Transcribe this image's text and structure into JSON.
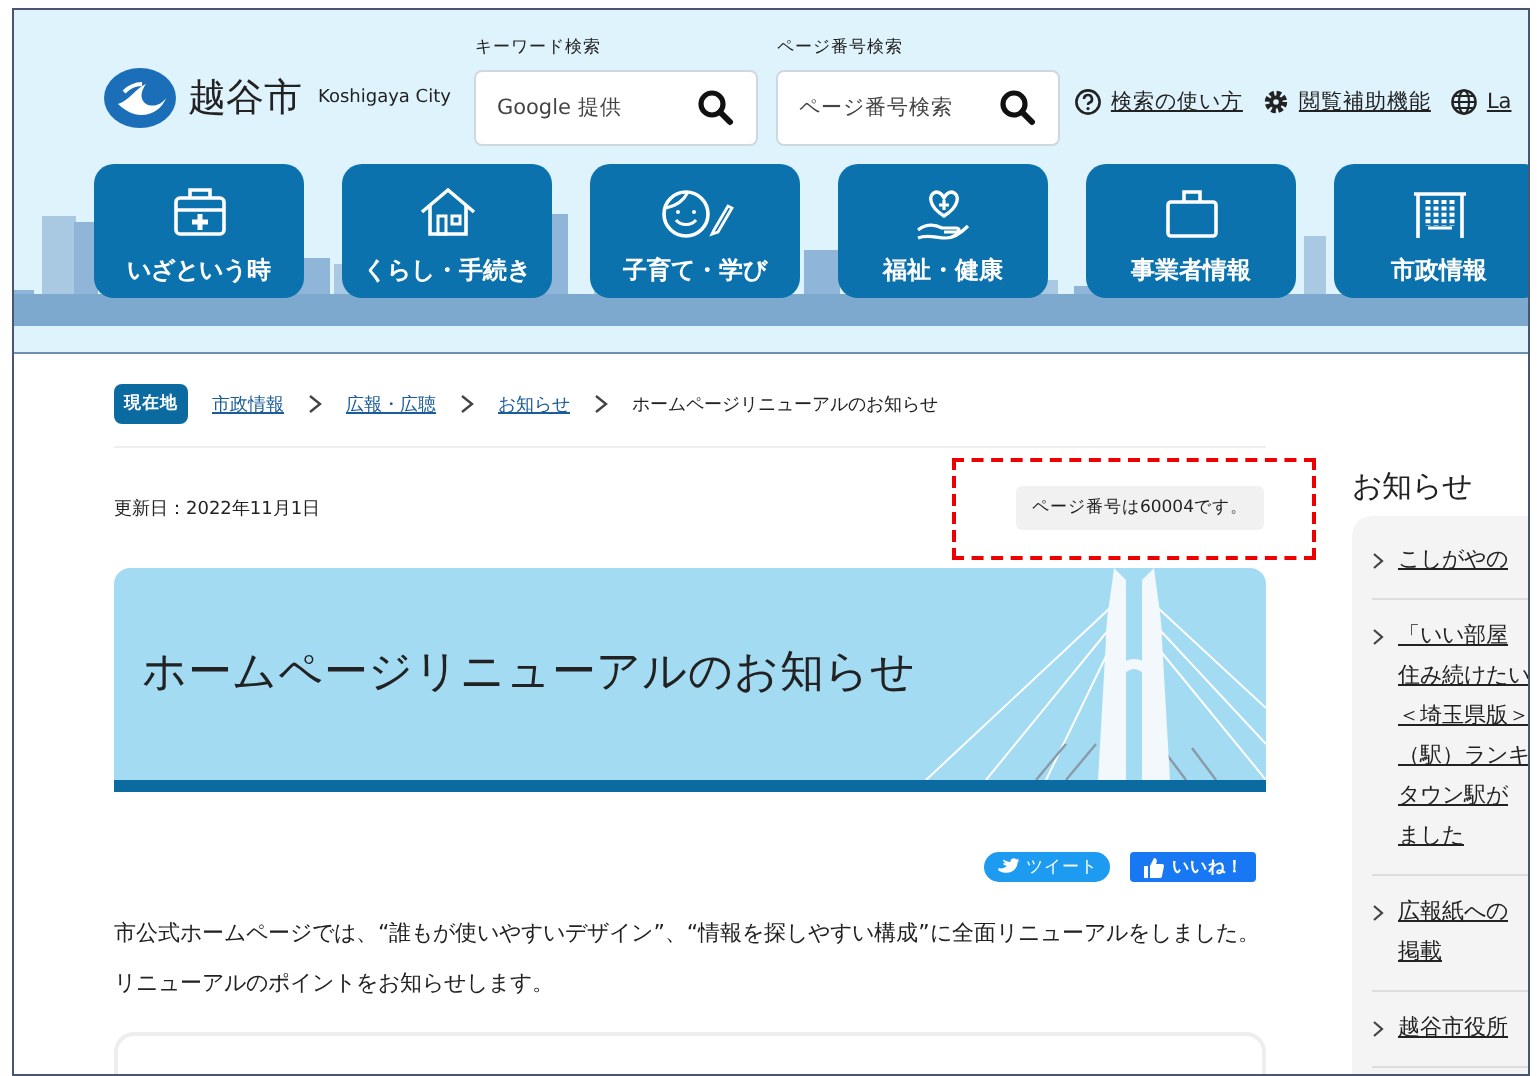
{
  "header": {
    "logo": {
      "name": "越谷市",
      "sub": "Koshigaya City"
    },
    "searches": [
      {
        "label": "キーワード検索",
        "placeholder": "Google 提供"
      },
      {
        "label": "ページ番号検索",
        "placeholder": "ページ番号検索"
      }
    ],
    "links": [
      {
        "kind": "help",
        "label": "検索の使い方"
      },
      {
        "kind": "settings",
        "label": "閲覧補助機能"
      },
      {
        "kind": "language",
        "label": "La"
      }
    ]
  },
  "nav": [
    {
      "kind": "emergency",
      "label": "いざという時"
    },
    {
      "kind": "home",
      "label": "くらし・手続き"
    },
    {
      "kind": "child",
      "label": "子育て・学び"
    },
    {
      "kind": "welfare",
      "label": "福祉・健康"
    },
    {
      "kind": "business",
      "label": "事業者情報"
    },
    {
      "kind": "city",
      "label": "市政情報"
    }
  ],
  "breadcrumb": {
    "badge": "現在地",
    "links": [
      "市政情報",
      "広報・広聴",
      "お知らせ"
    ],
    "current": "ホームページリニューアルのお知らせ"
  },
  "updated": "更新日：2022年11月1日",
  "page_number": {
    "text": "ページ番号は60004です。",
    "highlighted": true
  },
  "banner": {
    "title": "ホームページリニューアルのお知らせ"
  },
  "share": [
    {
      "kind": "twitter",
      "label": "ツイート"
    },
    {
      "kind": "facebook",
      "label": "いいね！"
    }
  ],
  "body": "市公式ホームページでは、“誰もが使いやすいデザイン”、“情報を探しやすい構成”に全面リニューアルをしました。リニューアルのポイントをお知らせします。",
  "news": {
    "title": "お知らせ",
    "items": [
      {
        "lines": [
          "こしがやの"
        ]
      },
      {
        "lines": [
          "「いい部屋",
          "住み続けたい",
          "＜埼玉県版＞",
          "（駅）ランキ",
          "タウン駅が",
          "ました"
        ]
      },
      {
        "lines": [
          "広報紙への",
          "掲載"
        ]
      },
      {
        "lines": [
          "越谷市役所"
        ]
      }
    ]
  }
}
